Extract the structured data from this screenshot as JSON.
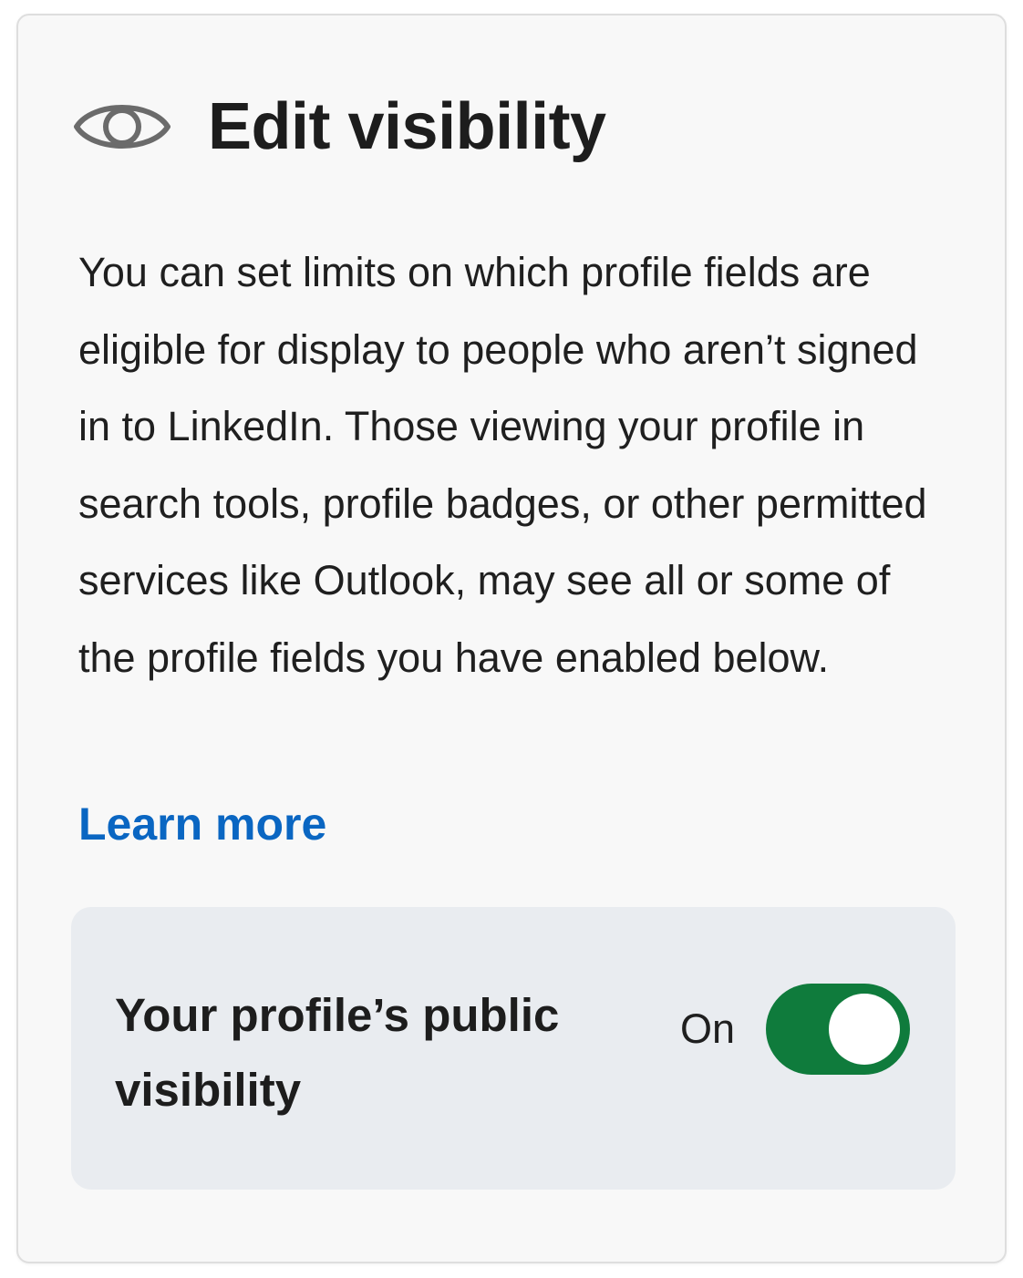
{
  "header": {
    "icon": "eye-icon",
    "title": "Edit visibility"
  },
  "description": "You can set limits on which profile fields are eligible for display to people who aren’t signed in to LinkedIn. Those viewing your profile in search tools, profile badges, or other permitted services like Outlook, may see all or some of the profile fields you have enabled below.",
  "learn_more": "Learn more",
  "public_visibility": {
    "label": "Your profile’s public visibility",
    "state_label": "On",
    "enabled": true
  },
  "colors": {
    "link": "#0a66c2",
    "toggle_on": "#0f7b3c",
    "panel_bg": "#e9ecf0",
    "card_bg": "#f8f8f8",
    "icon_gray": "#6b6b6b"
  }
}
